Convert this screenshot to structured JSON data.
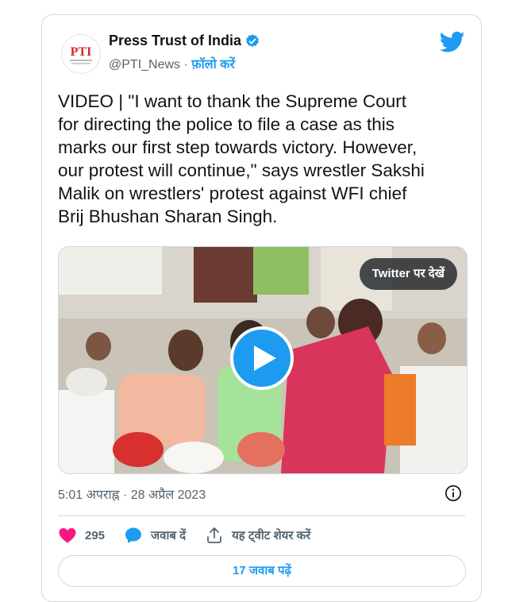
{
  "account": {
    "name": "Press Trust of India",
    "handle": "@PTI_News",
    "separator": " · ",
    "follow_label": "फ़ॉलो करें",
    "avatar_text": "PTI",
    "verified": true
  },
  "tweet": {
    "text": "VIDEO | \"I want to thank the Supreme Court\nfor directing the police to file a case as this\nmarks our first step towards victory. However,\nour protest will continue,\" says wrestler Sakshi\nMalik on wrestlers' protest against WFI chief\nBrij Bhushan Sharan Singh.",
    "timestamp": "5:01 अपराह्न · 28 अप्रैल 2023"
  },
  "media": {
    "type": "video",
    "watch_label": "Twitter पर देखें"
  },
  "actions": {
    "likes_count": "295",
    "reply_label": "जवाब दें",
    "share_label": "यह ट्वीट शेयर करें"
  },
  "footer": {
    "read_replies_label": "17 जवाब पढ़ें"
  },
  "colors": {
    "accent": "#1d9bf0",
    "like": "#f91880",
    "text": "#0f1419",
    "muted": "#536471",
    "border": "#cfd9de"
  },
  "icons": [
    "pti-logo",
    "verified-badge-icon",
    "twitter-bird-icon",
    "play-icon",
    "info-icon",
    "heart-icon",
    "reply-bubble-icon",
    "share-icon"
  ]
}
